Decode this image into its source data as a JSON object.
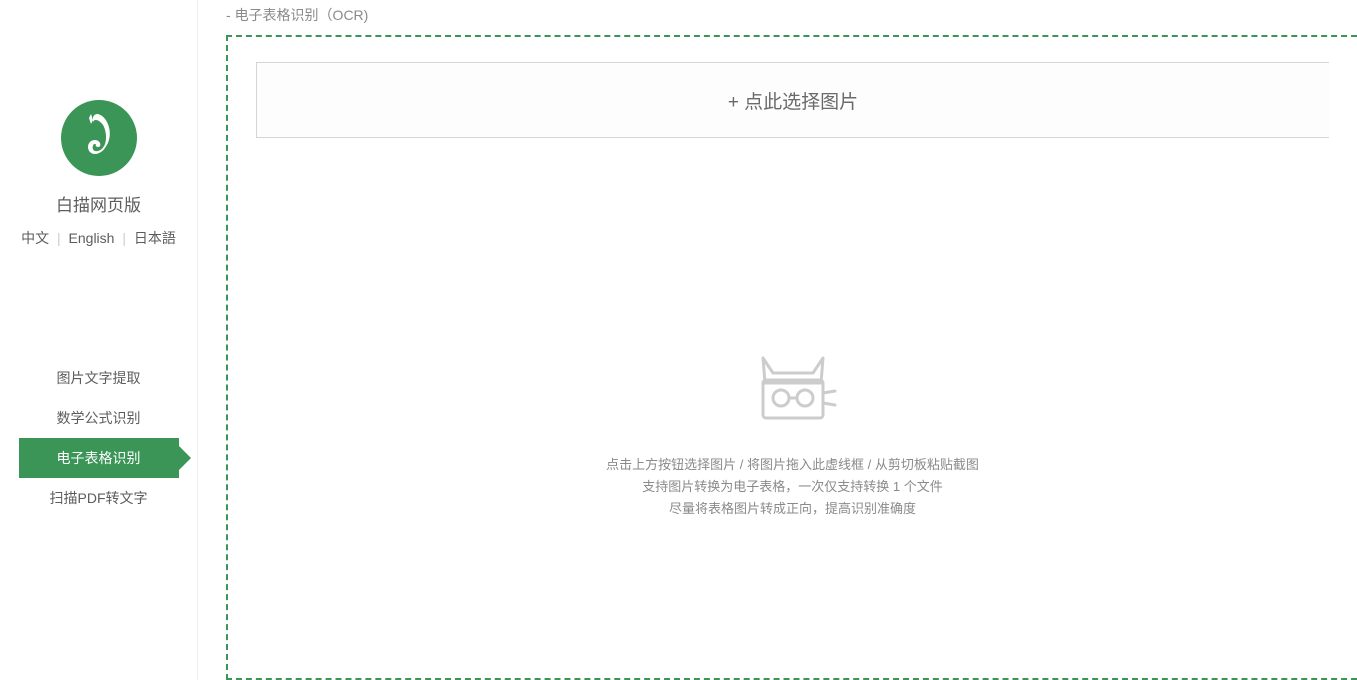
{
  "sidebar": {
    "app_title": "白描网页版",
    "languages": {
      "zh": "中文",
      "en": "English",
      "ja": "日本語"
    },
    "nav_items": [
      {
        "label": "图片文字提取"
      },
      {
        "label": "数学公式识别"
      },
      {
        "label": "电子表格识别"
      },
      {
        "label": "扫描PDF转文字"
      }
    ]
  },
  "main": {
    "header_prefix": "- ",
    "header_title": "电子表格识别（OCR)",
    "select_button_label": "+ 点此选择图片",
    "hints": {
      "line1": "点击上方按钮选择图片 / 将图片拖入此虚线框 / 从剪切板粘贴截图",
      "line2": "支持图片转换为电子表格，一次仅支持转换 1 个文件",
      "line3": "尽量将表格图片转成正向，提高识别准确度"
    }
  }
}
